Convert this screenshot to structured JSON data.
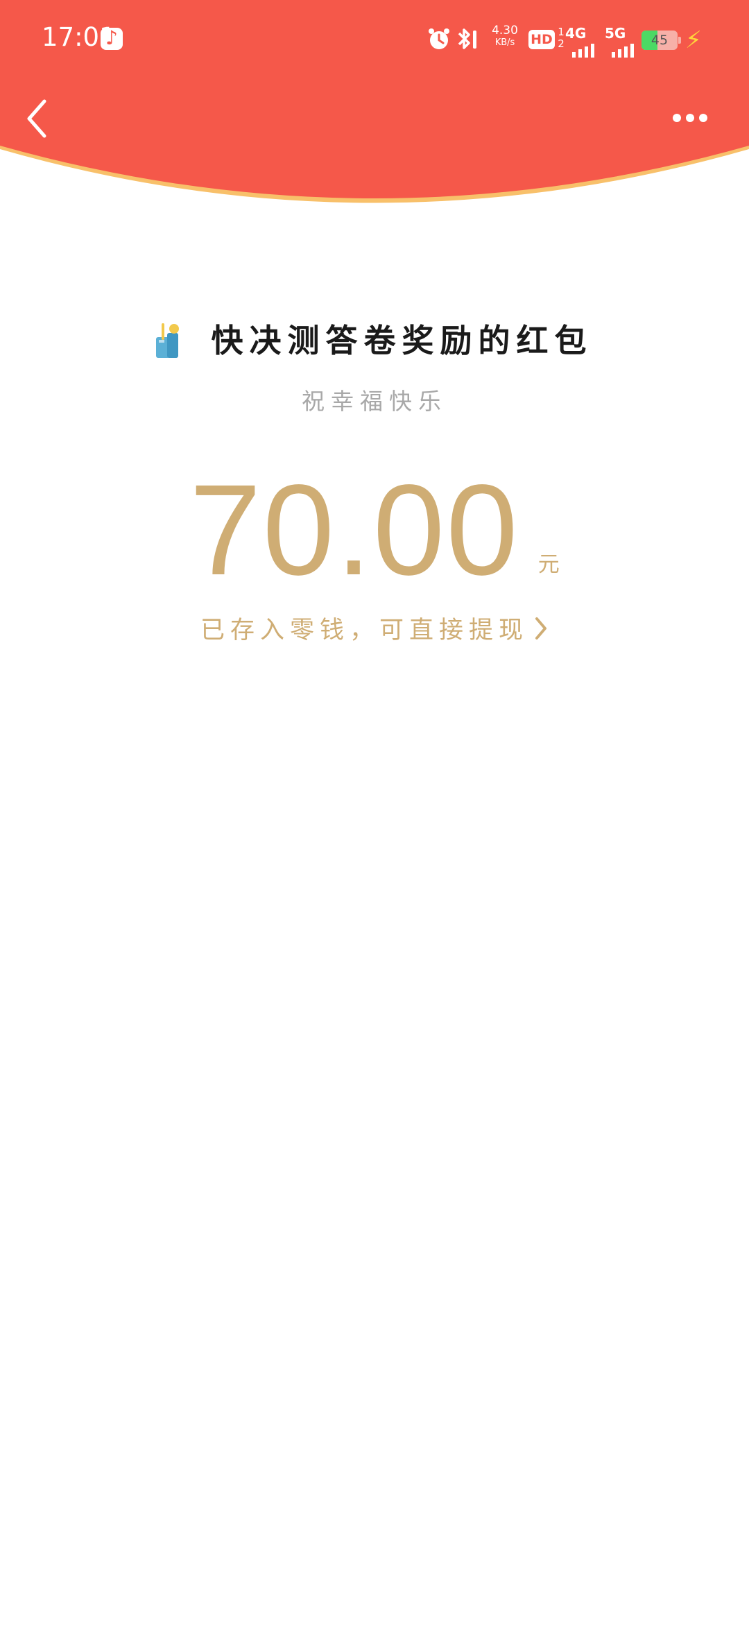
{
  "status_bar": {
    "time": "17:01",
    "net_speed_value": "4.30",
    "net_speed_unit": "KB/s",
    "hd_label": "HD",
    "hd_sub": "1\n2",
    "network_1": "4G",
    "network_2": "5G",
    "battery_level": "45",
    "icons": [
      "tiktok-icon",
      "alarm-icon",
      "bluetooth-icon",
      "signal-4g-icon",
      "signal-5g-icon",
      "battery-icon",
      "charging-bolt-icon"
    ]
  },
  "nav": {
    "back_icon": "chevron-left-icon",
    "more_icon": "more-dots-icon"
  },
  "red_packet": {
    "sender_avatar_icon": "survey-app-icon",
    "sender_title": "快决测答卷奖励的红包",
    "greeting": "祝幸福快乐",
    "amount": "70.00",
    "currency": "元",
    "withdraw_text": "已存入零钱，可直接提现",
    "withdraw_icon": "chevron-right-icon"
  },
  "colors": {
    "header_red": "#f5584a",
    "rim_gold": "#f8c06a",
    "amount_gold": "#cfad74",
    "title_black": "#1a1a1a",
    "greeting_gray": "#a8a8a8"
  }
}
